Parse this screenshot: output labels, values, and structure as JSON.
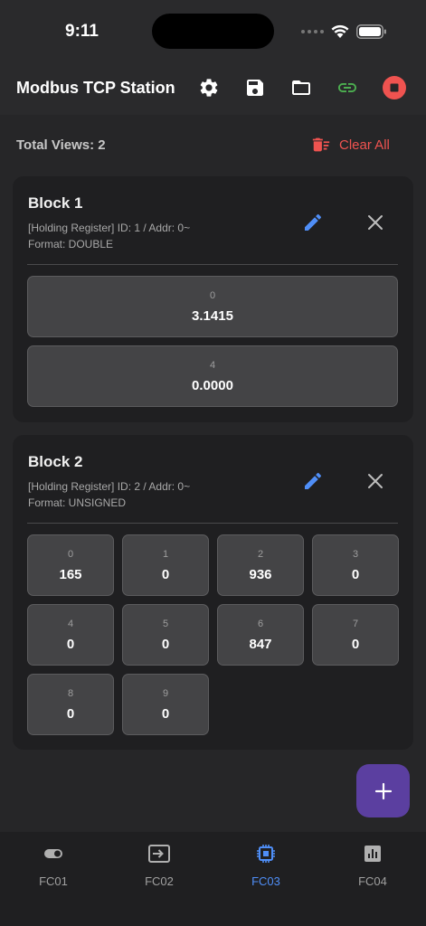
{
  "status_bar": {
    "time": "9:11"
  },
  "app_bar": {
    "title": "Modbus TCP Station"
  },
  "toolbar": {
    "total_views": "Total Views: 2",
    "clear_all": "Clear All"
  },
  "blocks": [
    {
      "title": "Block 1",
      "meta_line1": "[Holding Register] ID: 1 / Addr: 0~",
      "meta_line2": "Format: DOUBLE",
      "cells": [
        {
          "index": "0",
          "value": "3.1415"
        },
        {
          "index": "4",
          "value": "0.0000"
        }
      ]
    },
    {
      "title": "Block 2",
      "meta_line1": "[Holding Register] ID: 2 / Addr: 0~",
      "meta_line2": "Format: UNSIGNED",
      "cells": [
        {
          "index": "0",
          "value": "165"
        },
        {
          "index": "1",
          "value": "0"
        },
        {
          "index": "2",
          "value": "936"
        },
        {
          "index": "3",
          "value": "0"
        },
        {
          "index": "4",
          "value": "0"
        },
        {
          "index": "5",
          "value": "0"
        },
        {
          "index": "6",
          "value": "847"
        },
        {
          "index": "7",
          "value": "0"
        },
        {
          "index": "8",
          "value": "0"
        },
        {
          "index": "9",
          "value": "0"
        }
      ]
    }
  ],
  "bottom_nav": {
    "items": [
      {
        "label": "FC01",
        "icon": "toggle-icon",
        "active": false
      },
      {
        "label": "FC02",
        "icon": "input-icon",
        "active": false
      },
      {
        "label": "FC03",
        "icon": "chip-icon",
        "active": true
      },
      {
        "label": "FC04",
        "icon": "bar-chart-icon",
        "active": false
      }
    ]
  },
  "colors": {
    "accent_blue": "#4f8ef7",
    "danger_red": "#ef5350",
    "link_green": "#4caf50",
    "fab_purple": "#5b3fa0"
  }
}
